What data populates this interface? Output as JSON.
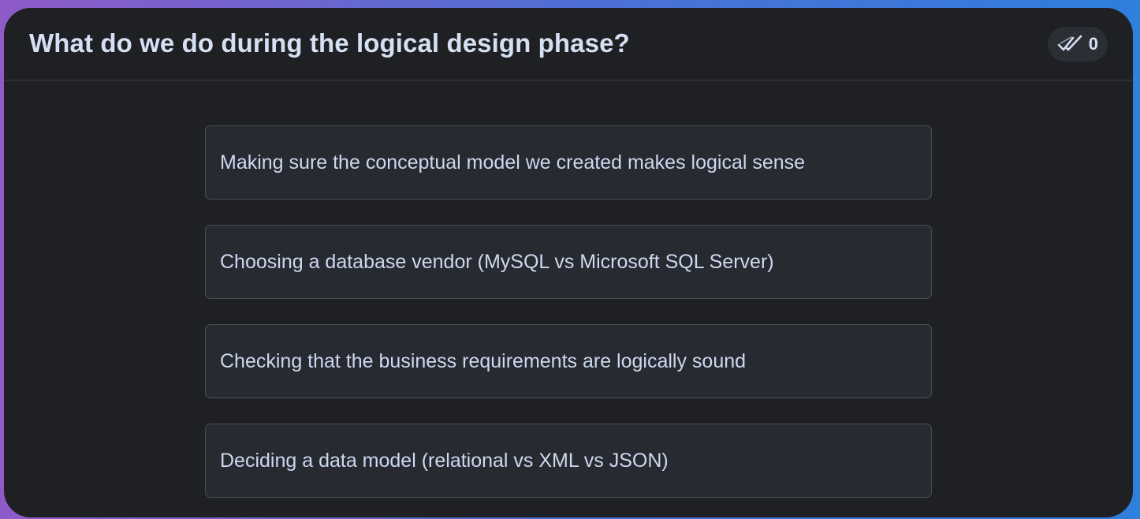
{
  "question": {
    "title": "What do we do during the logical design phase?"
  },
  "votes": {
    "icon": "double-check-icon",
    "count": "0"
  },
  "options": [
    {
      "label": "Making sure the conceptual model we created makes logical sense"
    },
    {
      "label": "Choosing a database vendor (MySQL vs Microsoft SQL Server)"
    },
    {
      "label": "Checking that the business requirements are logically sound"
    },
    {
      "label": "Deciding a data model (relational vs XML vs JSON)"
    }
  ],
  "colors": {
    "card_background": "#1f2023",
    "option_background": "#272a31",
    "text": "#d6e0f5",
    "gradient_start": "#8e5bc8",
    "gradient_end": "#2f7fdc"
  }
}
